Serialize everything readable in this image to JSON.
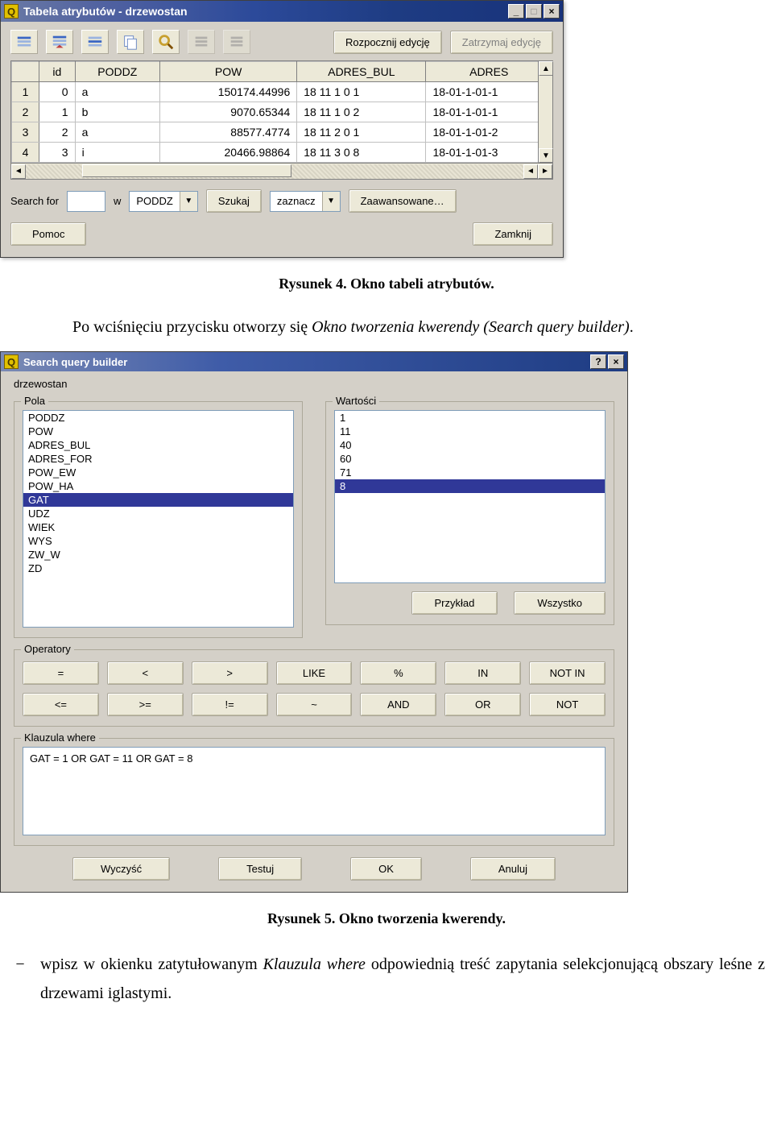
{
  "window1": {
    "title": "Tabela atrybutów - drzewostan",
    "toolbar_buttons": {
      "start_edit": "Rozpocznij edycję",
      "stop_edit": "Zatrzymaj edycję"
    },
    "columns": [
      "id",
      "PODDZ",
      "POW",
      "ADRES_BUL",
      "ADRES"
    ],
    "rows": [
      {
        "n": "1",
        "id": "0",
        "poddz": "a",
        "pow": "150174.44996",
        "adres_bul": "18 11   1 0 1",
        "adres": "18-01-1-01-1"
      },
      {
        "n": "2",
        "id": "1",
        "poddz": "b",
        "pow": "9070.65344",
        "adres_bul": "18 11   1 0 2",
        "adres": "18-01-1-01-1"
      },
      {
        "n": "3",
        "id": "2",
        "poddz": "a",
        "pow": "88577.4774",
        "adres_bul": "18 11   2 0 1",
        "adres": "18-01-1-01-2"
      },
      {
        "n": "4",
        "id": "3",
        "poddz": "i",
        "pow": "20466.98864",
        "adres_bul": "18 11   3 0 8",
        "adres": "18-01-1-01-3"
      }
    ],
    "search": {
      "label_for": "Search for",
      "label_in": "w",
      "field": "PODDZ",
      "btn_search": "Szukaj",
      "btn_mark": "zaznacz",
      "btn_adv": "Zaawansowane…",
      "btn_help": "Pomoc",
      "btn_close": "Zamknij"
    }
  },
  "caption1": "Rysunek 4. Okno tabeli atrybutów.",
  "para1_pre": "Po wciśnięciu przycisku otworzy się ",
  "para1_em": "Okno tworzenia kwerendy (Search query builder)",
  "para1_post": ".",
  "window2": {
    "title": "Search query builder",
    "layer": "drzewostan",
    "group_fields": "Pola",
    "group_values": "Wartości",
    "group_ops": "Operatory",
    "group_where": "Klauzula where",
    "fields": [
      "PODDZ",
      "POW",
      "ADRES_BUL",
      "ADRES_FOR",
      "POW_EW",
      "POW_HA",
      "GAT",
      "UDZ",
      "WIEK",
      "WYS",
      "ZW_W",
      "ZD"
    ],
    "fields_selected": "GAT",
    "values": [
      "1",
      "11",
      "40",
      "60",
      "71",
      "8"
    ],
    "values_selected": "8",
    "btn_sample": "Przykład",
    "btn_all": "Wszystko",
    "operators": [
      "=",
      "<",
      ">",
      "LIKE",
      "%",
      "IN",
      "NOT IN",
      "<=",
      ">=",
      "!=",
      "~",
      "AND",
      "OR",
      "NOT"
    ],
    "where_clause": "GAT = 1 OR GAT = 11 OR GAT = 8",
    "btn_clear": "Wyczyść",
    "btn_test": "Testuj",
    "btn_ok": "OK",
    "btn_cancel": "Anuluj"
  },
  "caption2": "Rysunek 5. Okno tworzenia kwerendy.",
  "para2_dash": "−",
  "para2_a": "wpisz  w  okienku  zatytułowanym  ",
  "para2_em": "Klauzula  where",
  "para2_b": "  odpowiednią  treść  zapytania selekcjonującą obszary leśne z drzewami iglastymi."
}
